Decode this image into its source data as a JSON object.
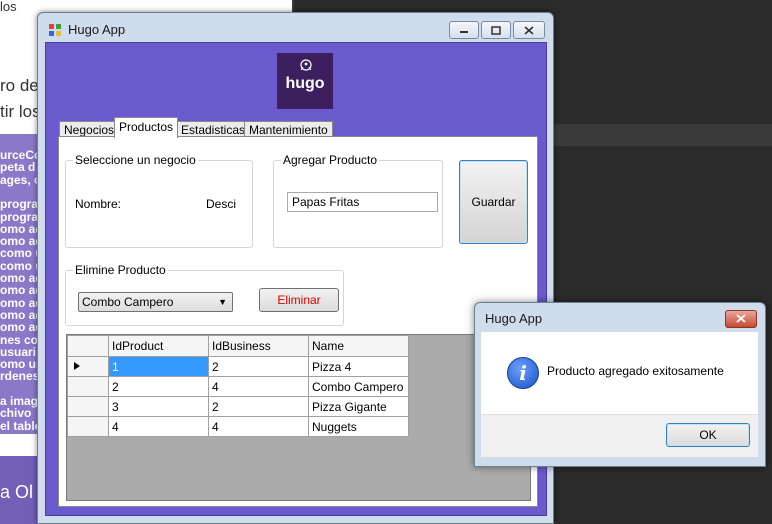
{
  "background": {
    "top_snippet": "los",
    "heading_line1": "ro de",
    "heading_line2": "tir los",
    "purple_lines": [
      "urceCo",
      "peta d",
      "ages, c",
      "",
      "prograr",
      "prograr",
      "omo adm",
      "omo adm",
      "como u",
      "como u",
      "omo adm",
      "omo adm",
      "omo adm",
      "omo adm",
      "omo adm",
      "nes co",
      "usuari",
      "omo usu",
      "rdenes",
      "",
      "a imag",
      "chivo",
      "el table"
    ],
    "bottom_text": "a Ol"
  },
  "main_window": {
    "title": "Hugo App",
    "logo_text": "hugo",
    "tabs": [
      {
        "label": "Negocios"
      },
      {
        "label": "Productos"
      },
      {
        "label": "Estadisticas"
      },
      {
        "label": "Mantenimiento"
      }
    ],
    "select_business": {
      "legend": "Seleccione un negocio",
      "name_label": "Nombre:",
      "desc_label": "Desci"
    },
    "add_product": {
      "legend": "Agregar Producto",
      "value": "Papas Fritas"
    },
    "save_label": "Guardar",
    "remove_product": {
      "legend": "Elimine Producto",
      "selected": "Combo Campero",
      "button_label": "Eliminar"
    },
    "table": {
      "columns": [
        "IdProduct",
        "IdBusiness",
        "Name"
      ],
      "rows": [
        [
          "1",
          "2",
          "Pizza 4"
        ],
        [
          "2",
          "4",
          "Combo Campero"
        ],
        [
          "3",
          "2",
          "Pizza Gigante"
        ],
        [
          "4",
          "4",
          "Nuggets"
        ]
      ]
    }
  },
  "message_box": {
    "title": "Hugo App",
    "message": "Producto agregado exitosamente",
    "ok_label": "OK",
    "icon": "info-icon"
  },
  "colors": {
    "client_bg": "#6a5acd",
    "logo_bg": "#3b1f5f",
    "selection": "#3399ff",
    "delete_text": "#e00000"
  }
}
